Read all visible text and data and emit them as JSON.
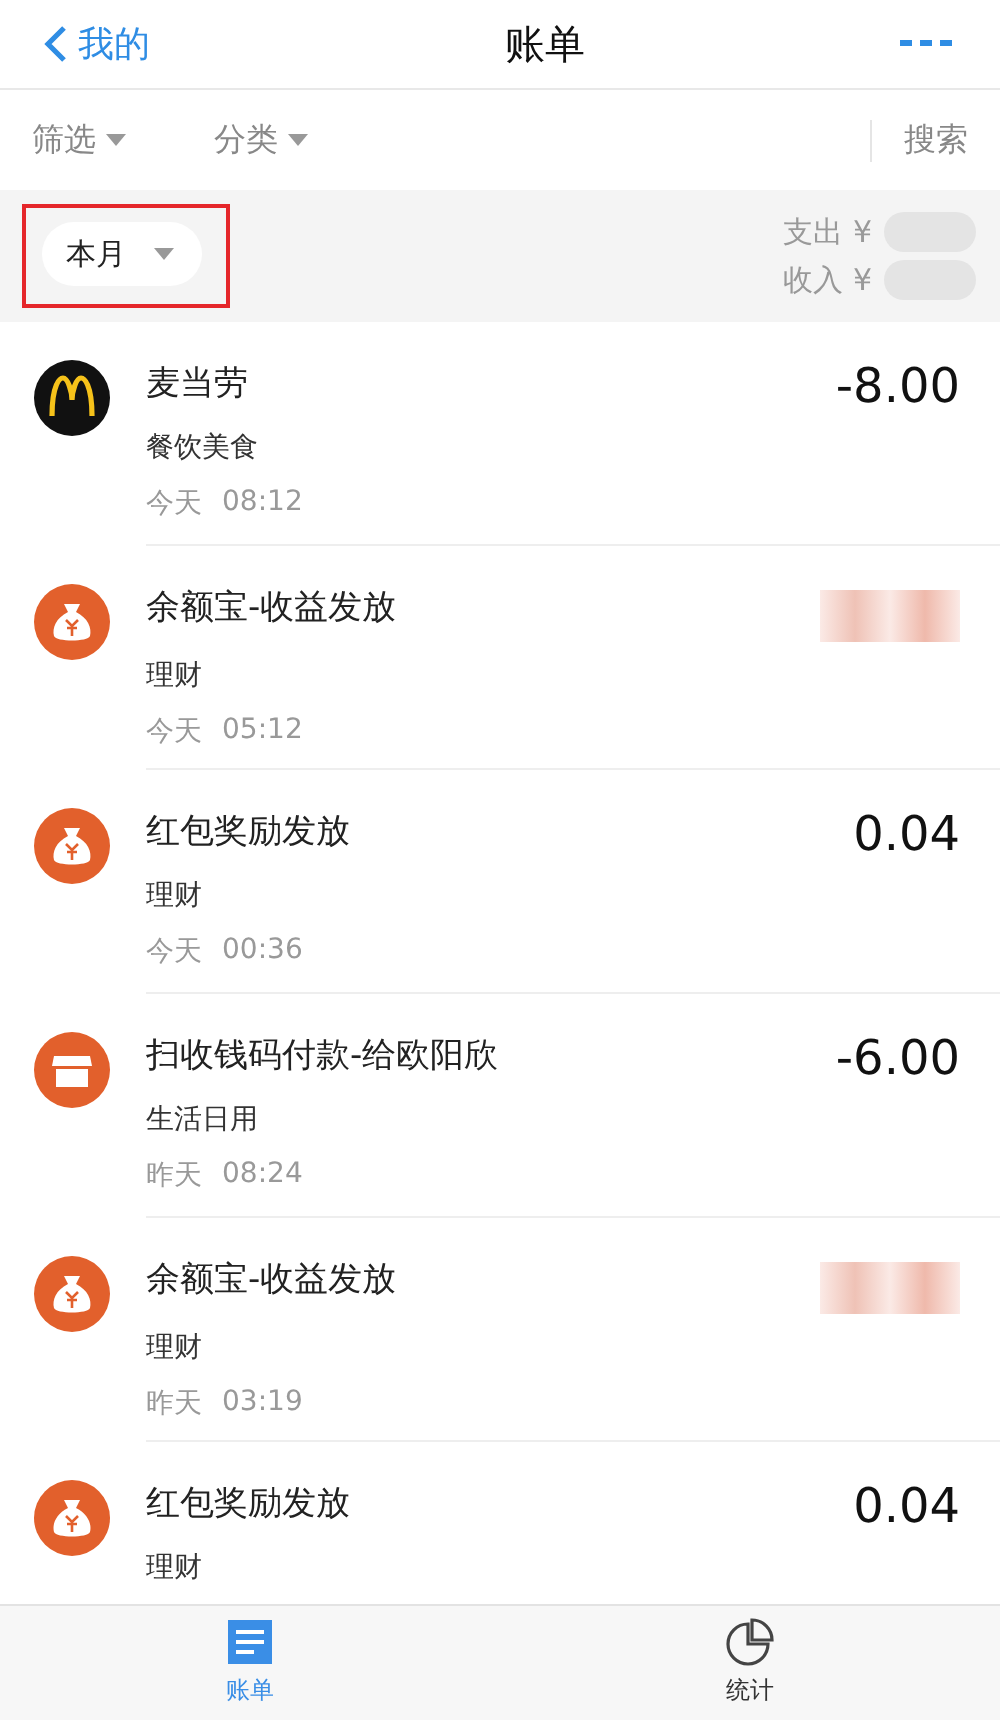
{
  "nav": {
    "back_label": "我的",
    "title": "账单"
  },
  "filters": {
    "items": [
      {
        "label": "筛选"
      },
      {
        "label": "分类"
      }
    ],
    "search_label": "搜索"
  },
  "summary": {
    "month_filter": {
      "label": "本月",
      "highlighted": true
    },
    "expense_label": "支出 ¥",
    "income_label": "收入 ¥"
  },
  "transactions": [
    {
      "kind": "arches",
      "title": "麦当劳",
      "category": "餐饮美食",
      "day": "今天",
      "time": "08:12",
      "amount": "-8.00"
    },
    {
      "kind": "money-bag",
      "title": "余额宝-收益发放",
      "category": "理财",
      "day": "今天",
      "time": "05:12"
    },
    {
      "kind": "money-bag",
      "title": "红包奖励发放",
      "category": "理财",
      "day": "今天",
      "time": "00:36",
      "amount": "0.04"
    },
    {
      "kind": "shop",
      "title": "扫收钱码付款-给欧阳欣",
      "category": "生活日用",
      "day": "昨天",
      "time": "08:24",
      "amount": "-6.00"
    },
    {
      "kind": "money-bag",
      "title": "余额宝-收益发放",
      "category": "理财",
      "day": "昨天",
      "time": "03:19"
    },
    {
      "kind": "money-bag",
      "title": "红包奖励发放",
      "category": "理财",
      "amount": "0.04"
    }
  ],
  "tab_bar": [
    {
      "kind": "bill",
      "label": "账单",
      "selected": true
    },
    {
      "kind": "stats",
      "label": "统计",
      "selected": false
    }
  ]
}
